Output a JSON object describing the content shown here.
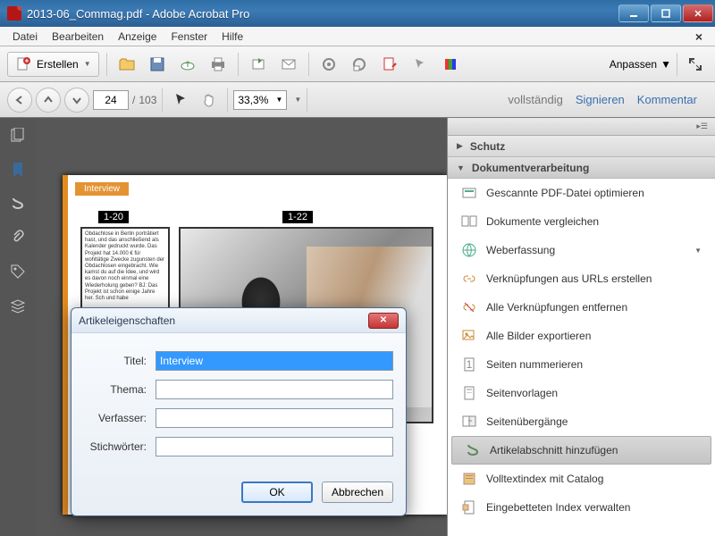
{
  "window": {
    "title": "2013-06_Commag.pdf - Adobe Acrobat Pro"
  },
  "menu": {
    "file": "Datei",
    "edit": "Bearbeiten",
    "view": "Anzeige",
    "window": "Fenster",
    "help": "Hilfe"
  },
  "toolbar": {
    "create": "Erstellen",
    "customize": "Anpassen"
  },
  "nav": {
    "page_current": "24",
    "page_sep": "/",
    "page_total": "103",
    "zoom": "33,3%"
  },
  "rightlinks": {
    "full": "vollständig",
    "sign": "Signieren",
    "comment": "Kommentar"
  },
  "doc": {
    "article_label": "Interview",
    "tag1": "1-20",
    "tag2": "1-22",
    "blurb": "Obdachlose in Berlin porträtiert hast, und das anschließend als Kalender gedruckt wurde. Das Projekt hat 14.000 € für wohltätige Zwecke zugunsten der Obdachlosen eingebracht. Wie kamst du auf die Idee, und wird es davon noch einmal eine Wiederholung geben? BJ: Das Projekt ist schon einige Jahre her. Sch und habe "
  },
  "rpanel": {
    "security": "Schutz",
    "processing": "Dokumentverarbeitung",
    "items": [
      "Gescannte PDF-Datei optimieren",
      "Dokumente vergleichen",
      "Weberfassung",
      "Verknüpfungen aus URLs erstellen",
      "Alle Verknüpfungen entfernen",
      "Alle Bilder exportieren",
      "Seiten nummerieren",
      "Seitenvorlagen",
      "Seitenübergänge",
      "Artikelabschnitt hinzufügen",
      "Volltextindex mit Catalog",
      "Eingebetteten Index verwalten"
    ]
  },
  "dialog": {
    "title": "Artikeleigenschaften",
    "f_title": "Titel:",
    "f_theme": "Thema:",
    "f_author": "Verfasser:",
    "f_keywords": "Stichwörter:",
    "v_title": "Interview",
    "ok": "OK",
    "cancel": "Abbrechen"
  }
}
